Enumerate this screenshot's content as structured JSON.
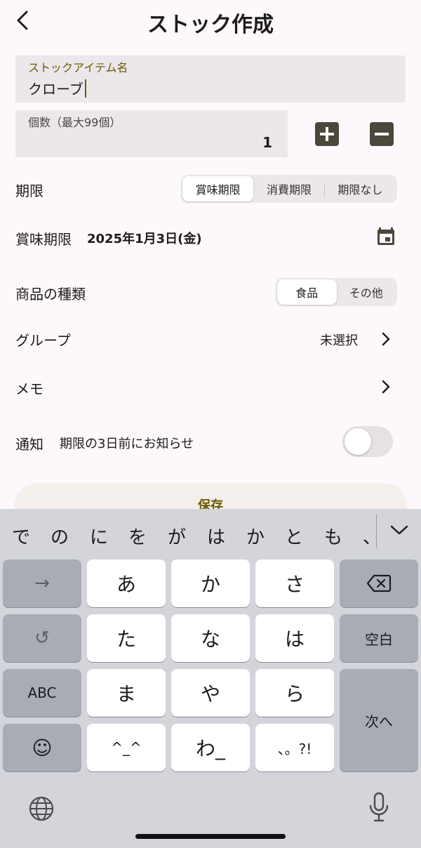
{
  "header": {
    "title": "ストック作成"
  },
  "item_name": {
    "label": "ストックアイテム名",
    "value": "クローブ"
  },
  "count": {
    "label": "個数（最大99個）",
    "value": "1"
  },
  "expiry": {
    "label": "期限",
    "options": [
      "賞味期限",
      "消費期限",
      "期限なし"
    ],
    "selected": "賞味期限"
  },
  "date": {
    "label": "賞味期限",
    "value": "2025年1月3日(金)"
  },
  "product_type": {
    "label": "商品の種類",
    "options": [
      "食品",
      "その他"
    ],
    "selected": "食品"
  },
  "group": {
    "label": "グループ",
    "value": "未選択"
  },
  "memo": {
    "label": "メモ"
  },
  "notification": {
    "label": "通知",
    "text": "期限の3日前にお知らせ",
    "enabled": false
  },
  "save": {
    "label": "保存"
  },
  "keyboard": {
    "candidates": [
      "で",
      "の",
      "に",
      "を",
      "が",
      "は",
      "か",
      "と",
      "も",
      "、"
    ],
    "keys": {
      "r1": [
        "→",
        "あ",
        "か",
        "さ",
        "⌫"
      ],
      "r2": [
        "↺",
        "た",
        "な",
        "は",
        "空白"
      ],
      "r3": [
        "ABC",
        "ま",
        "や",
        "ら",
        "次へ"
      ],
      "r4": [
        "☺",
        "^_^",
        "わ_",
        "、。?!"
      ]
    }
  },
  "colors": {
    "accent": "#6b5a00",
    "button_dark": "#4a473b",
    "background": "#fdf8fb"
  }
}
